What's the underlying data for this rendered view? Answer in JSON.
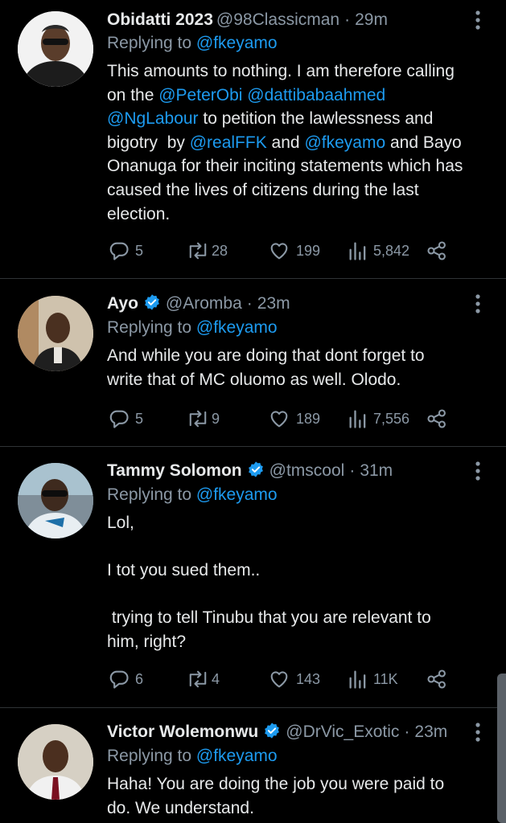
{
  "tweets": [
    {
      "name": "Obidatti 2023",
      "handle": "@98Classicman",
      "time": "29m",
      "verified": false,
      "reply_prefix": "Replying to ",
      "reply_to": "@fkeyamo",
      "lines": [
        [
          {
            "t": "This amounts to nothing. I am therefore calling"
          }
        ],
        [
          {
            "t": "on the "
          },
          {
            "t": "@PeterObi",
            "m": true
          },
          {
            "t": " "
          },
          {
            "t": "@dattibabaahmed",
            "m": true
          }
        ],
        [
          {
            "t": "@NgLabour",
            "m": true
          },
          {
            "t": " to petition the lawlessness and"
          }
        ],
        [
          {
            "t": "bigotry  by "
          },
          {
            "t": "@realFFK",
            "m": true
          },
          {
            "t": " and "
          },
          {
            "t": "@fkeyamo",
            "m": true
          },
          {
            "t": " and Bayo"
          }
        ],
        [
          {
            "t": "Onanuga for their inciting statements which has"
          }
        ],
        [
          {
            "t": "caused the lives of citizens during the last"
          }
        ],
        [
          {
            "t": "election."
          }
        ]
      ],
      "replies": "5",
      "retweets": "28",
      "likes": "199",
      "views": "5,842",
      "avatar_bg": "#ffffff"
    },
    {
      "name": "Ayo",
      "handle": "@Aromba",
      "time": "23m",
      "verified": true,
      "reply_prefix": "Replying to ",
      "reply_to": "@fkeyamo",
      "lines": [
        [
          {
            "t": "And while you are doing that dont forget to"
          }
        ],
        [
          {
            "t": "write that of MC oluomo as well. Olodo."
          }
        ]
      ],
      "replies": "5",
      "retweets": "9",
      "likes": "189",
      "views": "7,556",
      "avatar_bg": "#c9b9a3"
    },
    {
      "name": "Tammy Solomon",
      "handle": "@tmscool",
      "time": "31m",
      "verified": true,
      "reply_prefix": "Replying to ",
      "reply_to": "@fkeyamo",
      "lines": [
        [
          {
            "t": "Lol,"
          }
        ],
        [
          {
            "t": ""
          }
        ],
        [
          {
            "t": "I tot you sued them.."
          }
        ],
        [
          {
            "t": ""
          }
        ],
        [
          {
            "t": " trying to tell Tinubu that you are relevant to"
          }
        ],
        [
          {
            "t": "him, right?"
          }
        ]
      ],
      "replies": "6",
      "retweets": "4",
      "likes": "143",
      "views": "11K",
      "avatar_bg": "#8fb3c9"
    },
    {
      "name": "Victor Wolemonwu",
      "handle": "@DrVic_Exotic",
      "time": "23m",
      "verified": true,
      "reply_prefix": "Replying to ",
      "reply_to": "@fkeyamo",
      "lines": [
        [
          {
            "t": "Haha! You are doing the job you were paid to"
          }
        ],
        [
          {
            "t": "do. We understand."
          }
        ]
      ],
      "avatar_bg": "#d8d2c6"
    }
  ],
  "colors": {
    "background": "#000000",
    "text": "#e7e9ea",
    "secondary": "#8b98a5",
    "mention": "#1d9bf0",
    "verified": "#1d9bf0",
    "divider": "#2f3336"
  }
}
